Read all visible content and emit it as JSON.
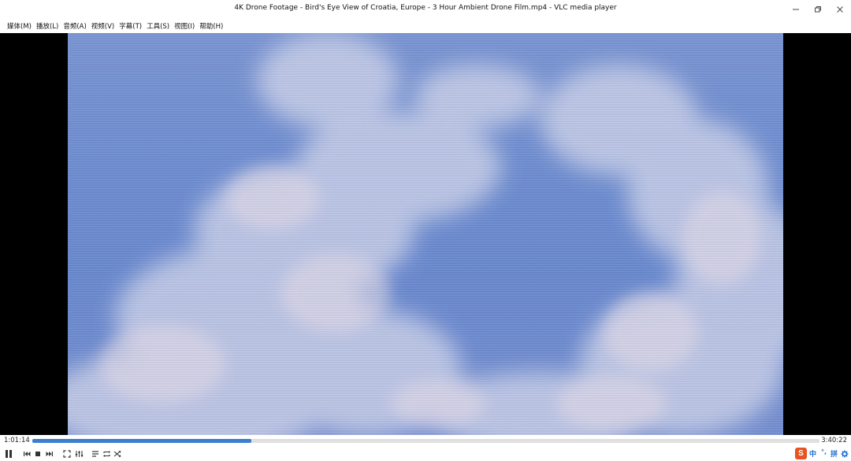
{
  "window": {
    "title": "4K Drone Footage - Bird's Eye View of Croatia, Europe - 3 Hour Ambient Drone Film.mp4 - VLC media player"
  },
  "menu": {
    "items": [
      {
        "label": "媒体(M)"
      },
      {
        "label": "播放(L)"
      },
      {
        "label": "音频(A)"
      },
      {
        "label": "视频(V)"
      },
      {
        "label": "字幕(T)"
      },
      {
        "label": "工具(S)"
      },
      {
        "label": "视图(I)"
      },
      {
        "label": "帮助(H)"
      }
    ]
  },
  "playback": {
    "elapsed": "1:01:14",
    "total": "3:40:22",
    "progress": 0.278
  },
  "tray": {
    "ime_logo": "S",
    "ime_mode": "中",
    "ime_pinyin": "拼"
  },
  "colors": {
    "seek_fill": "#3a7fd0",
    "ime_brand": "#e8531f"
  }
}
